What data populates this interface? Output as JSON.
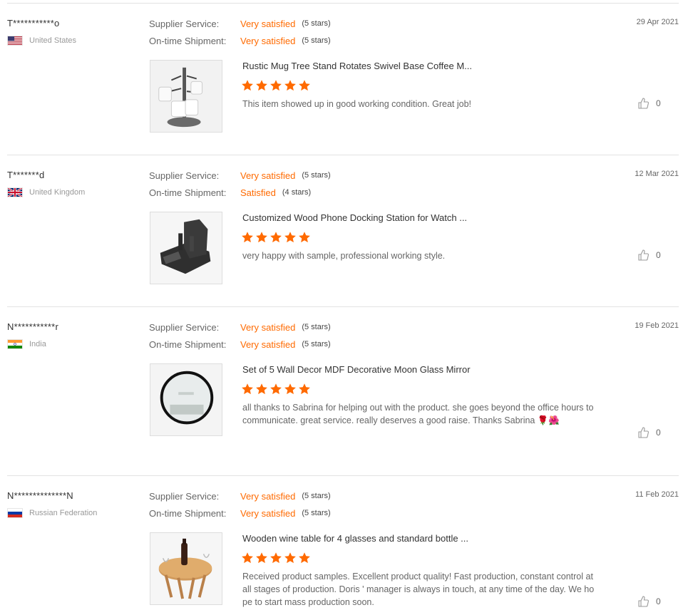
{
  "labels": {
    "supplier_service": "Supplier Service:",
    "ontime_shipment": "On-time Shipment:"
  },
  "colors": {
    "accent": "#ff6a00",
    "star": "#ff6a00"
  },
  "reviews": [
    {
      "buyer": "T***********o",
      "country": "United States",
      "flag": "us-flag",
      "date": "29 Apr 2021",
      "supplier_service": {
        "text": "Very satisfied",
        "stars": "(5 stars)"
      },
      "ontime_shipment": {
        "text": "Very satisfied",
        "stars": "(5 stars)"
      },
      "product_title": "Rustic Mug Tree Stand Rotates Swivel Base Coffee M...",
      "product_rating": 5,
      "comment": "This item showed up in good working condition.  Great job!",
      "likes": "0",
      "thumb": "mug-tree-stand-image"
    },
    {
      "buyer": "T*******d",
      "country": "United Kingdom",
      "flag": "uk-flag",
      "date": "12 Mar 2021",
      "supplier_service": {
        "text": "Very satisfied",
        "stars": "(5 stars)"
      },
      "ontime_shipment": {
        "text": "Satisfied",
        "stars": "(4 stars)"
      },
      "product_title": "Customized Wood Phone Docking Station for Watch ...",
      "product_rating": 5,
      "comment": "very happy with sample, professional working style.",
      "likes": "0",
      "thumb": "phone-docking-station-image"
    },
    {
      "buyer": "N***********r",
      "country": "India",
      "flag": "india-flag",
      "date": "19 Feb 2021",
      "supplier_service": {
        "text": "Very satisfied",
        "stars": "(5 stars)"
      },
      "ontime_shipment": {
        "text": "Very satisfied",
        "stars": "(5 stars)"
      },
      "product_title": "Set of 5 Wall Decor MDF Decorative Moon Glass Mirror",
      "product_rating": 5,
      "comment": "all thanks to Sabrina for helping out with the product. she goes beyond the office hours to communicate. great service.  really deserves a good raise. Thanks Sabrina 🌹🌺",
      "likes": "0",
      "thumb": "round-mirror-image"
    },
    {
      "buyer": "N**************N",
      "country": "Russian Federation",
      "flag": "russia-flag",
      "date": "11 Feb 2021",
      "supplier_service": {
        "text": "Very satisfied",
        "stars": "(5 stars)"
      },
      "ontime_shipment": {
        "text": "Very satisfied",
        "stars": "(5 stars)"
      },
      "product_title": "Wooden wine table for 4 glasses and standard bottle ...",
      "product_rating": 5,
      "comment": "Received product samples. Excellent product quality! Fast production, constant control at all stages of production. Doris ' manager is always in touch, at any time of the day. We hope to start mass production soon.",
      "likes": "0",
      "thumb": "wine-table-image"
    }
  ]
}
